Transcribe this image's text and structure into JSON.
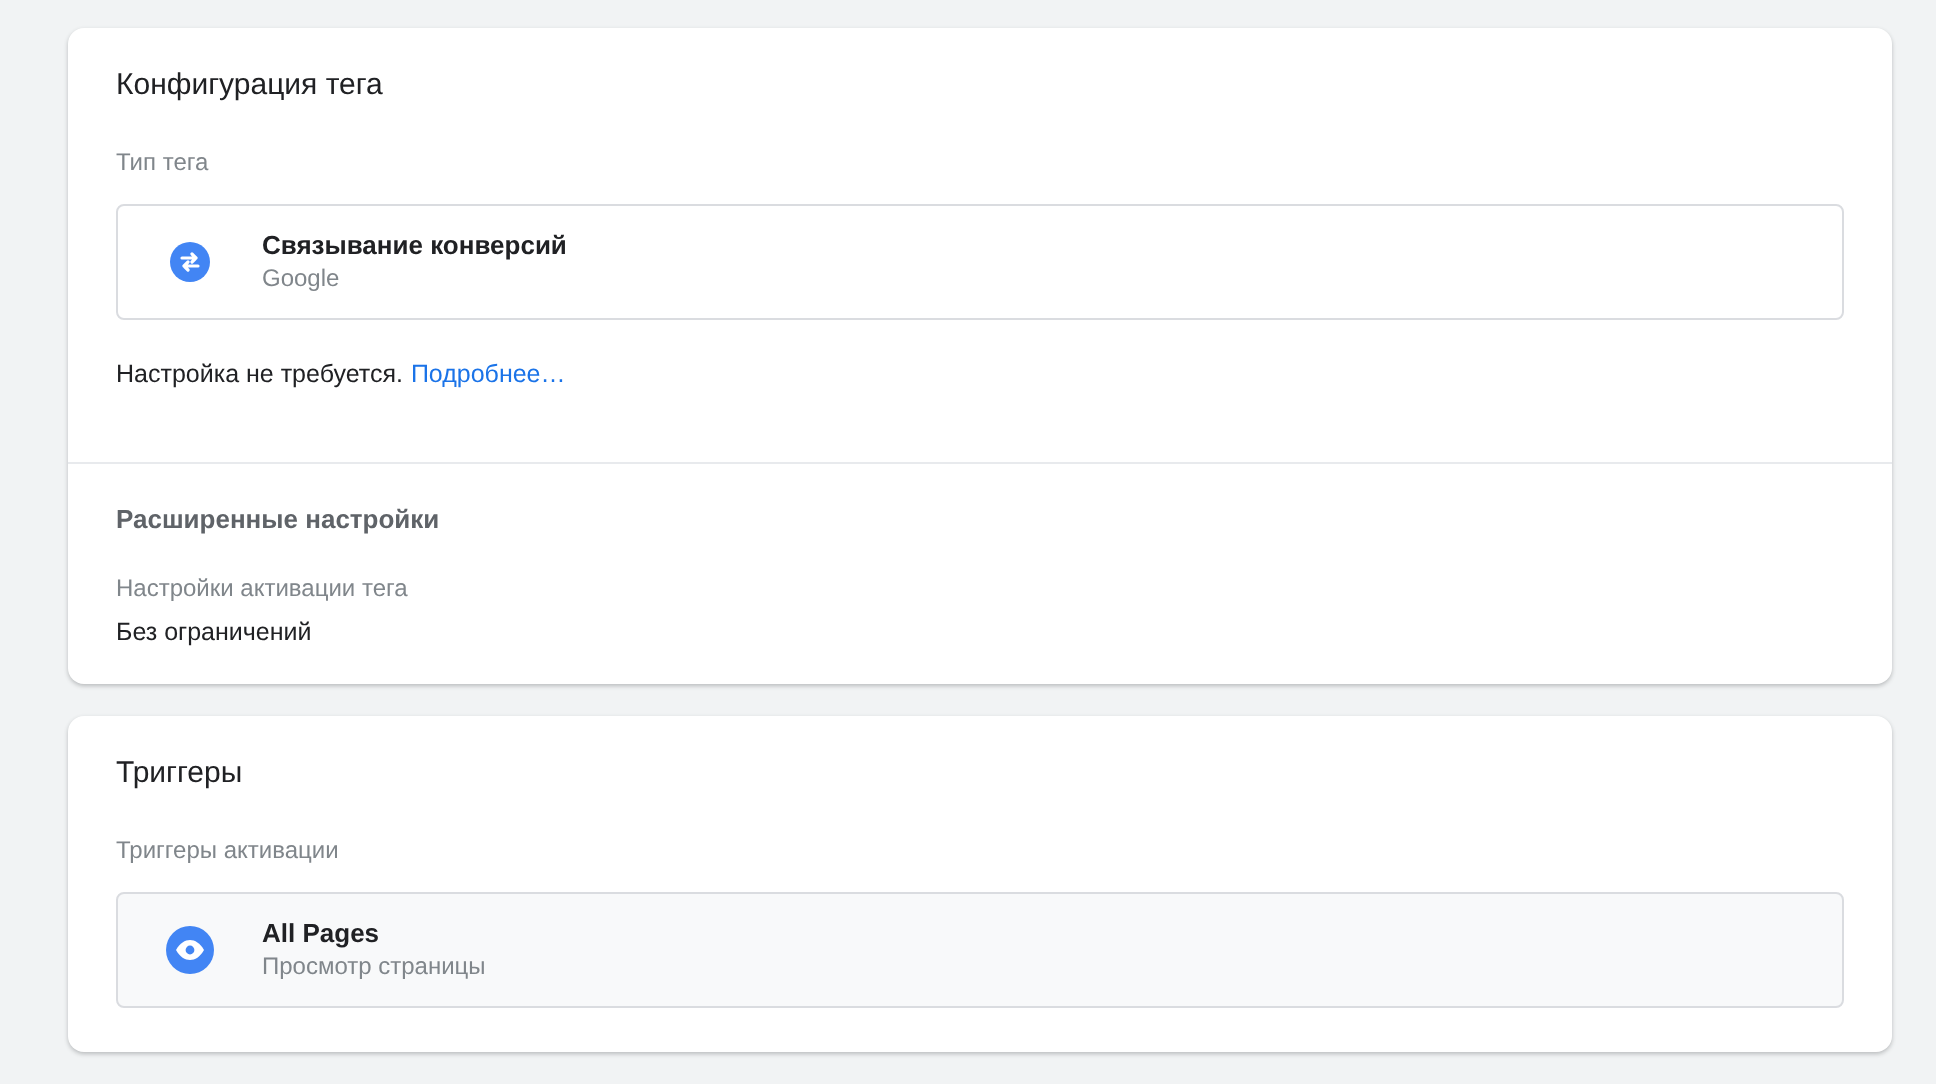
{
  "tag_configuration": {
    "title": "Конфигурация тега",
    "tag_type_label": "Тип тега",
    "tag_type": {
      "kind": "conversion-linker",
      "name": "Связывание конверсий",
      "vendor": "Google"
    },
    "note": "Настройка не требуется.",
    "note_link": "Подробнее…",
    "advanced": {
      "title": "Расширенные настройки",
      "firing_label": "Настройки активации тега",
      "firing_value": "Без ограничений"
    }
  },
  "triggers": {
    "title": "Триггеры",
    "firing_label": "Триггеры активации",
    "items": [
      {
        "kind": "pageview",
        "name": "All Pages",
        "type": "Просмотр страницы"
      }
    ]
  }
}
